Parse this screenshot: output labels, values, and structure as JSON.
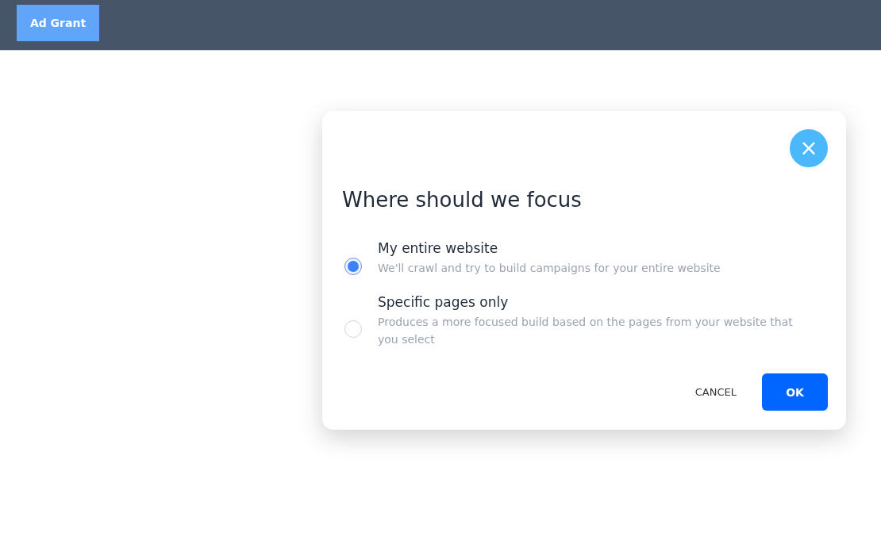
{
  "header": {
    "button": "Ad Grant"
  },
  "dialog": {
    "close": "×",
    "title": "Where should we focus",
    "options": [
      {
        "label": "My entire website",
        "description": "We'll crawl and try to build campaigns for your entire website",
        "selected": true
      },
      {
        "label": "Specific pages only",
        "description": "Produces a more focused build based on the pages from your website that you select",
        "selected": false
      }
    ],
    "buttons": [
      {
        "label": "CANCEL",
        "kind": "text"
      },
      {
        "label": "OK",
        "kind": "primary"
      }
    ]
  }
}
